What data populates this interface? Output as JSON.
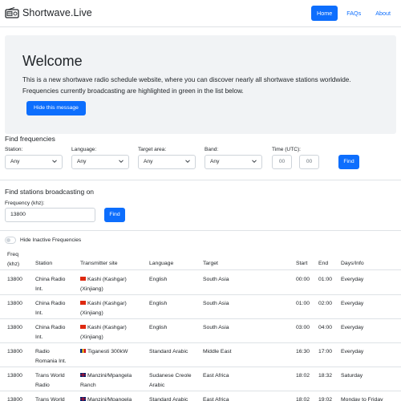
{
  "brand": {
    "name": "Shortwave.Live",
    "icon": "radio-icon"
  },
  "nav": {
    "items": [
      "Home",
      "FAQs",
      "About"
    ],
    "active": "Home"
  },
  "welcome": {
    "title": "Welcome",
    "text": "This is a new shortwave radio schedule website, where you can discover nearly all shortwave stations worldwide. Frequencies currently broadcasting are highlighted in green in the list below.",
    "hide_button": "Hide this message"
  },
  "find_frequencies": {
    "title": "Find frequencies",
    "station_label": "Station:",
    "station_value": "Any",
    "language_label": "Language:",
    "language_value": "Any",
    "target_label": "Target area:",
    "target_value": "Any",
    "band_label": "Band:",
    "band_value": "Any",
    "time_label": "Time (UTC):",
    "time_hour_placeholder": "00",
    "time_min_placeholder": "00",
    "find_button": "Find"
  },
  "find_stations": {
    "title": "Find stations broadcasting on",
    "freq_label": "Frequency (khz):",
    "freq_value": "13800",
    "find_button": "Find"
  },
  "toggle": {
    "label": "Hide Inactive Frequencies",
    "checked": false
  },
  "table": {
    "headers": {
      "freq_line1": "Freq",
      "freq_line2": "(khz)",
      "station": "Station",
      "site": "Transmitter site",
      "language": "Language",
      "target": "Target",
      "start": "Start",
      "end": "End",
      "days": "Days/Info"
    },
    "rows": [
      {
        "freq": "13800",
        "station1": "China Radio",
        "station2": "Int.",
        "flag": "china-flag-icon",
        "site1": "Kashi (Kashgar)",
        "site2": "(Xinjiang)",
        "language1": "English",
        "language2": "",
        "target": "South Asia",
        "start": "00:00",
        "end": "01:00",
        "days": "Everyday"
      },
      {
        "freq": "13800",
        "station1": "China Radio",
        "station2": "Int.",
        "flag": "china-flag-icon",
        "site1": "Kashi (Kashgar)",
        "site2": "(Xinjiang)",
        "language1": "English",
        "language2": "",
        "target": "South Asia",
        "start": "01:00",
        "end": "02:00",
        "days": "Everyday"
      },
      {
        "freq": "13800",
        "station1": "China Radio",
        "station2": "Int.",
        "flag": "china-flag-icon",
        "site1": "Kashi (Kashgar)",
        "site2": "(Xinjiang)",
        "language1": "English",
        "language2": "",
        "target": "South Asia",
        "start": "03:00",
        "end": "04:00",
        "days": "Everyday"
      },
      {
        "freq": "13800",
        "station1": "Radio",
        "station2": "Romania Int.",
        "flag": "romania-flag-icon",
        "site1": "Tiganesti 300kW",
        "site2": "",
        "language1": "Standard Arabic",
        "language2": "",
        "target": "Middle East",
        "start": "16:30",
        "end": "17:00",
        "days": "Everyday"
      },
      {
        "freq": "13800",
        "station1": "Trans World",
        "station2": "Radio",
        "flag": "uk-flag-icon",
        "site1": "Manzini/Mpangela",
        "site2": "Ranch",
        "language1": "Sudanese Creole",
        "language2": "Arabic",
        "target": "East Africa",
        "start": "18:02",
        "end": "18:32",
        "days": "Saturday"
      },
      {
        "freq": "13800",
        "station1": "Trans World",
        "station2": "",
        "flag": "uk-flag-icon",
        "site1": "Manzini/Mpangela",
        "site2": "",
        "language1": "Standard Arabic",
        "language2": "",
        "target": "East Africa",
        "start": "18:02",
        "end": "19:02",
        "days": "Monday to Friday"
      }
    ]
  }
}
